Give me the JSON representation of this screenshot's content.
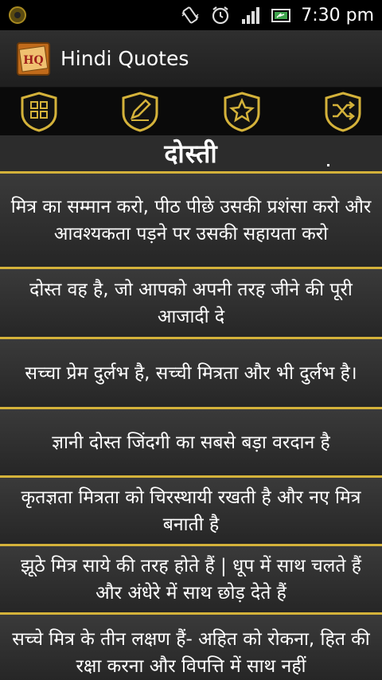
{
  "status_bar": {
    "time": "7:30 pm"
  },
  "app": {
    "title": "Hindi Quotes",
    "icon_label": "HQ"
  },
  "toolbar": {
    "buttons": [
      {
        "icon": "list-icon"
      },
      {
        "icon": "edit-icon"
      },
      {
        "icon": "star-icon"
      },
      {
        "icon": "shuffle-icon"
      }
    ]
  },
  "category": {
    "title": "दोस्ती"
  },
  "quotes": [
    "मित्र का सम्मान करो, पीठ पीछे उसकी प्रशंसा करो और आवश्यकता पड़ने पर उसकी सहायता करो",
    "दोस्त वह है, जो आपको अपनी तरह जीने की पूरी आजादी दे",
    "सच्चा प्रेम दुर्लभ है, सच्ची मित्रता और भी दुर्लभ है।",
    "ज्ञानी दोस्त जिंदगी का सबसे बड़ा वरदान है",
    "कृतज्ञता मित्रता को चिरस्थायी रखती है और नए मित्र बनाती है",
    "झूठे मित्र साये की तरह होते हैं | धूप में साथ चलते हैं और अंधेरे में साथ छोड़ देते हैं",
    "सच्चे मित्र के तीन लक्षण हैं- अहित को रोकना, हित की रक्षा करना और विपत्ति में साथ नहीं"
  ],
  "colors": {
    "accent": "#d4b23a",
    "background": "#2a2a2a"
  }
}
